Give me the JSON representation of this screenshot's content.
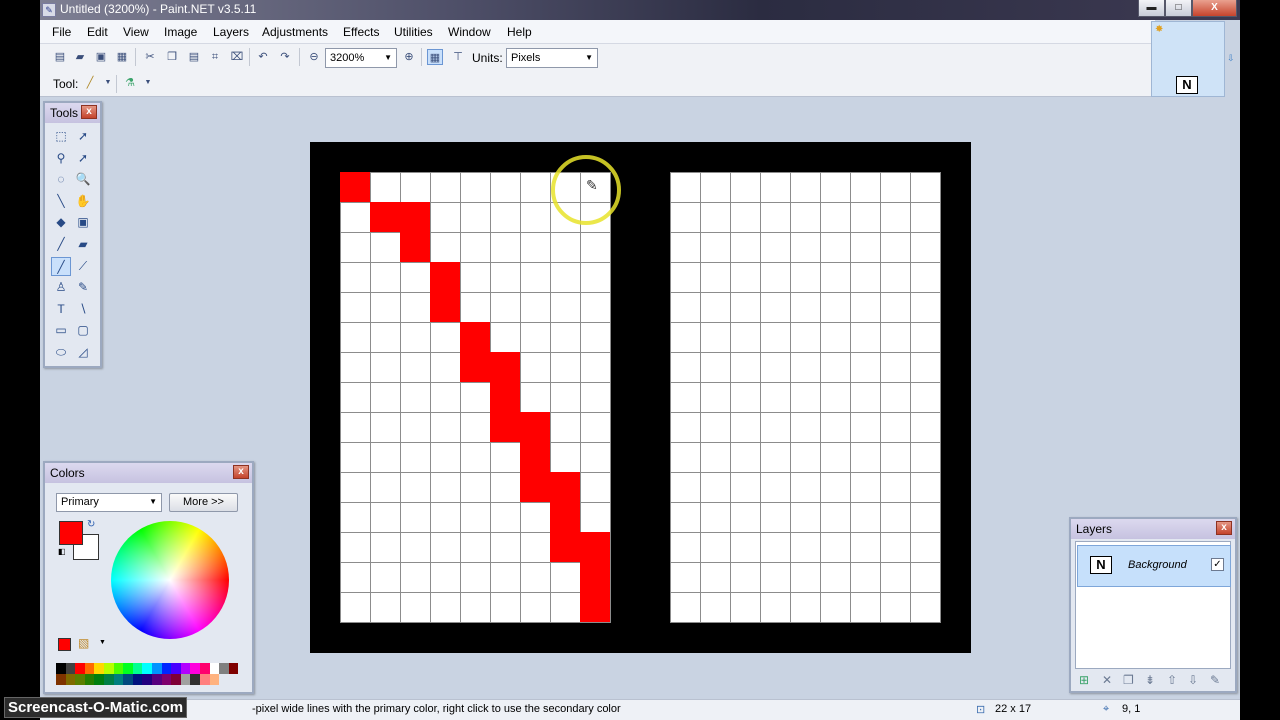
{
  "window": {
    "title": "Untitled (3200%) - Paint.NET v3.5.11",
    "app_icon": "paintnet-icon",
    "buttons": {
      "minimize": "▬",
      "maximize": "□",
      "close": "X"
    }
  },
  "menu": [
    "File",
    "Edit",
    "View",
    "Image",
    "Layers",
    "Adjustments",
    "Effects",
    "Utilities",
    "Window",
    "Help"
  ],
  "toolbar": {
    "zoom_value": "3200%",
    "units_label": "Units:",
    "units_value": "Pixels",
    "tool_label": "Tool:",
    "icons": [
      "new-icon",
      "open-icon",
      "save-icon",
      "print-icon",
      "cut-icon",
      "copy-icon",
      "paste-icon",
      "crop-icon",
      "deselect-icon",
      "undo-icon",
      "redo-icon",
      "zoom-out-icon",
      "zoom-in-icon",
      "grid-icon",
      "ruler-icon"
    ]
  },
  "tools_panel": {
    "title": "Tools",
    "close": "x",
    "tools": [
      {
        "name": "rectangle-select-icon",
        "glyph": "⬚"
      },
      {
        "name": "move-selection-icon",
        "glyph": "➚"
      },
      {
        "name": "lasso-select-icon",
        "glyph": "⚲"
      },
      {
        "name": "move-selected-icon",
        "glyph": "➚"
      },
      {
        "name": "ellipse-select-icon",
        "glyph": "◌"
      },
      {
        "name": "zoom-icon",
        "glyph": "🔍"
      },
      {
        "name": "magic-wand-icon",
        "glyph": "╲"
      },
      {
        "name": "pan-icon",
        "glyph": "✋"
      },
      {
        "name": "paint-bucket-icon",
        "glyph": "◆"
      },
      {
        "name": "gradient-icon",
        "glyph": "▣"
      },
      {
        "name": "paintbrush-icon",
        "glyph": "╱"
      },
      {
        "name": "eraser-icon",
        "glyph": "▰"
      },
      {
        "name": "pencil-icon",
        "glyph": "╱"
      },
      {
        "name": "color-picker-icon",
        "glyph": "⟋"
      },
      {
        "name": "clone-stamp-icon",
        "glyph": "♙"
      },
      {
        "name": "recolor-icon",
        "glyph": "✎"
      },
      {
        "name": "text-icon",
        "glyph": "T"
      },
      {
        "name": "line-curve-icon",
        "glyph": "∖"
      },
      {
        "name": "rectangle-icon",
        "glyph": "▭"
      },
      {
        "name": "rounded-rectangle-icon",
        "glyph": "▢"
      },
      {
        "name": "ellipse-icon",
        "glyph": "⬭"
      },
      {
        "name": "freeform-shape-icon",
        "glyph": "◿"
      }
    ],
    "selected_index": 12
  },
  "colors_panel": {
    "title": "Colors",
    "close": "x",
    "mode": "Primary",
    "more_button": "More >>",
    "primary_color": "#ff0000",
    "secondary_color": "#ffffff",
    "palette": [
      "#000000",
      "#404040",
      "#ff0000",
      "#ff6a00",
      "#ffd800",
      "#b6ff00",
      "#4cff00",
      "#00ff21",
      "#00ff90",
      "#00ffff",
      "#0094ff",
      "#0026ff",
      "#4800ff",
      "#b200ff",
      "#ff00dc",
      "#ff006e",
      "#ffffff",
      "#808080",
      "#7f0000",
      "#7f3300",
      "#7f6a00",
      "#5b7f00",
      "#267f00",
      "#007f0e",
      "#007f46",
      "#007f7f",
      "#004a7f",
      "#00137f",
      "#21007f",
      "#57007f",
      "#7f006e",
      "#7f0037",
      "#a0a0a0",
      "#303030",
      "#ff7f7f",
      "#ffb27f"
    ]
  },
  "canvas": {
    "cell": 30,
    "left_cols": 9,
    "right_cols": 9,
    "rows": 15,
    "red_cells": [
      [
        0,
        0
      ],
      [
        1,
        1
      ],
      [
        1,
        2
      ],
      [
        2,
        2
      ],
      [
        3,
        3
      ],
      [
        4,
        3
      ],
      [
        5,
        4
      ],
      [
        6,
        4
      ],
      [
        6,
        5
      ],
      [
        7,
        5
      ],
      [
        8,
        5
      ],
      [
        8,
        6
      ],
      [
        9,
        6
      ],
      [
        10,
        6
      ],
      [
        10,
        7
      ],
      [
        11,
        7
      ],
      [
        12,
        7
      ],
      [
        12,
        8
      ],
      [
        13,
        8
      ],
      [
        14,
        8
      ]
    ]
  },
  "layers_panel": {
    "title": "Layers",
    "close": "x",
    "layer_name": "Background",
    "layer_thumb": "N",
    "checked": "✓",
    "buttons": [
      "add-layer-icon",
      "delete-layer-icon",
      "duplicate-layer-icon",
      "merge-layer-icon",
      "move-up-icon",
      "move-down-icon",
      "properties-icon"
    ]
  },
  "thumbnail": {
    "label": "N"
  },
  "status": {
    "hint": "-pixel wide lines with the primary color, right click to use the secondary color",
    "image_size": "22 x 17",
    "cursor_pos": "9, 1"
  },
  "watermark": "Screencast-O-Matic.com"
}
